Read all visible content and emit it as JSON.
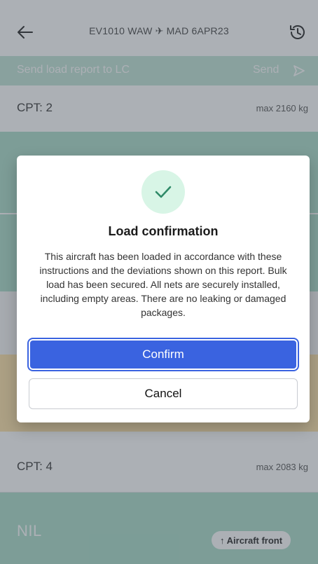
{
  "header": {
    "title": "EV1010 WAW ✈ MAD 6APR23",
    "back_icon": "arrow-left-icon",
    "history_icon": "history-icon"
  },
  "send_bar": {
    "label": "Send load report to LC",
    "send_label": "Send",
    "send_icon": "send-icon"
  },
  "compartments": [
    {
      "name": "CPT: 2",
      "max": "max 2160 kg"
    },
    {
      "name": "CPT: 4",
      "max": "max 2083 kg"
    }
  ],
  "bottom": {
    "nil_label": "NIL",
    "front_label": "↑ Aircraft front"
  },
  "modal": {
    "icon": "check-icon",
    "title": "Load confirmation",
    "body": "This aircraft has been loaded in accordance with these instructions and the deviations shown on this report. Bulk load has been secured. All nets are securely installed, including empty areas. There are no leaking or damaged packages.",
    "confirm_label": "Confirm",
    "cancel_label": "Cancel"
  },
  "colors": {
    "primary": "#3a63e0",
    "accent_green": "#a9dcc9",
    "success_bg": "#d8f5e6",
    "success_check": "#2f8a68",
    "cargo_orange": "#ffe2a6"
  }
}
